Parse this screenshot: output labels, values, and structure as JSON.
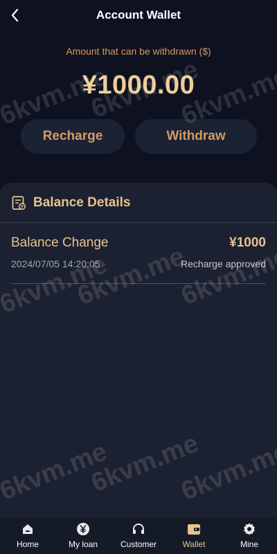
{
  "header": {
    "title": "Account Wallet"
  },
  "summary": {
    "withdraw_label": "Amount that can be withdrawn ($)",
    "amount": "¥1000.00",
    "recharge_label": "Recharge",
    "withdraw_button_label": "Withdraw"
  },
  "details": {
    "title": "Balance Details",
    "rows": [
      {
        "label": "Balance Change",
        "amount": "¥1000",
        "date": "2024/07/05 14:20:05",
        "status": "Recharge approved"
      }
    ]
  },
  "watermark": "6kvm.me",
  "nav": {
    "items": [
      {
        "label": "Home",
        "icon": "home-icon"
      },
      {
        "label": "My loan",
        "icon": "yen-coin-icon"
      },
      {
        "label": "Customer",
        "icon": "headset-icon"
      },
      {
        "label": "Wallet",
        "icon": "wallet-icon",
        "active": true
      },
      {
        "label": "Mine",
        "icon": "gear-icon"
      }
    ]
  },
  "colors": {
    "background": "#0e1220",
    "accent": "#d79a63",
    "gold": "#e6c48e",
    "card": "#1c2131"
  }
}
